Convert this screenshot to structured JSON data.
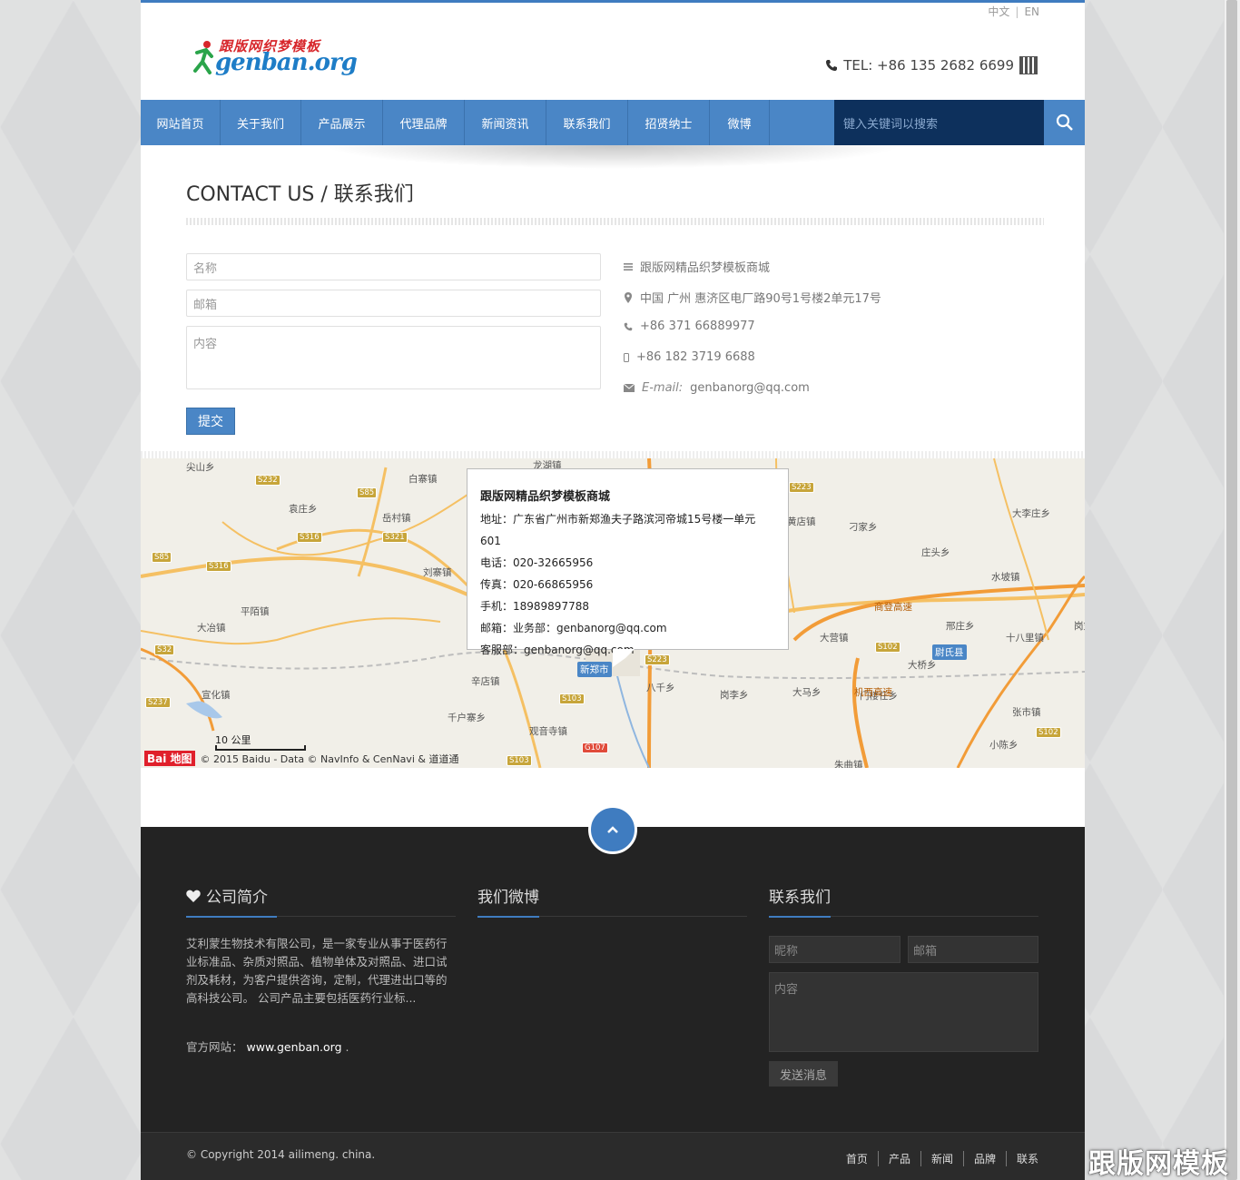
{
  "header": {
    "lang_zh": "中文",
    "lang_sep": "|",
    "lang_en": "EN",
    "logo_top": "跟版网织梦模板",
    "logo_bottom": "genban.org",
    "tel": "TEL: +86 135 2682 6699"
  },
  "nav": {
    "items": [
      "网站首页",
      "关于我们",
      "产品展示",
      "代理品牌",
      "新闻资讯",
      "联系我们",
      "招贤纳士",
      "微博"
    ],
    "search_placeholder": "键入关键词以搜索"
  },
  "contact": {
    "title": "CONTACT US / 联系我们",
    "name_placeholder": "名称",
    "email_placeholder": "邮箱",
    "content_placeholder": "内容",
    "submit": "提交",
    "company": "跟版网精品织梦模板商城",
    "address": "中国 广州 惠济区电厂路90号1号楼2单元17号",
    "phone": "+86 371 66889977",
    "mobile": "+86 182 3719 6688",
    "email_label": "E-mail:",
    "email": "genbanorg@qq.com"
  },
  "map": {
    "popup_title": "跟版网精品织梦模板商城",
    "popup_lines": [
      "地址：广东省广州市新郑渔夫子路滨河帝城15号楼一单元601",
      "电话：020-32665956",
      "传真：020-66865956",
      "手机：18989897788",
      "邮箱：业务部：genbanorg@qq.com",
      "客服部：genbanorg@qq.com"
    ],
    "scale": "10 公里",
    "logo": "Bai 地图",
    "copyright": "© 2015 Baidu - Data © NavInfo & CenNavi & 道道通",
    "places": [
      {
        "n": "尖山乡"
      },
      {
        "n": "白寨镇"
      },
      {
        "n": "龙湖镇"
      },
      {
        "n": "袁庄乡"
      },
      {
        "n": "岳村镇"
      },
      {
        "n": "刘寨镇"
      },
      {
        "n": "平陌镇"
      },
      {
        "n": "大冶镇"
      },
      {
        "n": "宣化镇"
      },
      {
        "n": "辛店镇"
      },
      {
        "n": "千户寨乡"
      },
      {
        "n": "观音寺镇"
      },
      {
        "n": "新郑市"
      },
      {
        "n": "八千乡"
      },
      {
        "n": "岗李乡"
      },
      {
        "n": "大马乡"
      },
      {
        "n": "门楼任乡"
      },
      {
        "n": "黄店镇"
      },
      {
        "n": "刁家乡"
      },
      {
        "n": "庄头乡"
      },
      {
        "n": "水坡镇"
      },
      {
        "n": "邢庄乡"
      },
      {
        "n": "大营镇"
      },
      {
        "n": "尉氏县"
      },
      {
        "n": "大桥乡"
      },
      {
        "n": "十八里镇"
      },
      {
        "n": "大李庄乡"
      },
      {
        "n": "岗刘镇"
      },
      {
        "n": "张市镇"
      },
      {
        "n": "小陈乡"
      },
      {
        "n": "朱曲镇"
      },
      {
        "n": "商登高速"
      },
      {
        "n": "机西高速"
      }
    ],
    "road_badges": [
      "S232",
      "S85",
      "S316",
      "S321",
      "S316",
      "S85",
      "S32",
      "S237",
      "S223",
      "S223",
      "S103",
      "G107",
      "S102",
      "S102",
      "S103"
    ]
  },
  "footer": {
    "about_title": "公司简介",
    "weibo_title": "我们微博",
    "contact_title": "联系我们",
    "about_text": "艾利蒙生物技术有限公司，是一家专业从事于医药行业标准品、杂质对照品、植物单体及对照品、进口试剂及耗材，为客户提供咨询，定制，代理进出口等的高科技公司。 公司产品主要包括医药行业标...",
    "site_label": "官方网站：",
    "site_url": "www.genban.org",
    "site_suffix": ".",
    "nick_placeholder": "昵称",
    "email_placeholder": "邮箱",
    "content_placeholder": "内容",
    "send": "发送消息"
  },
  "bottom": {
    "copyright": "© Copyright 2014 ailimeng. china.",
    "links": [
      "首页",
      "产品",
      "新闻",
      "品牌",
      "联系"
    ]
  },
  "watermark": "跟版网模板",
  "colors": {
    "accent": "#4a86c6",
    "nav_search": "#0d305c",
    "footer": "#232323"
  }
}
